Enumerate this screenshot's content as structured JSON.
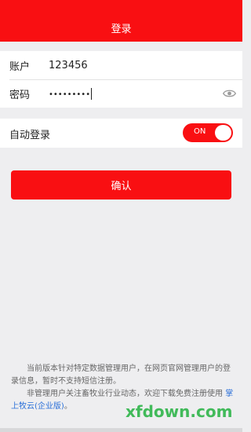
{
  "header": {
    "title": "登录"
  },
  "login": {
    "account_label": "账户",
    "account_value": "123456",
    "password_label": "密码",
    "password_value": "•••••••••"
  },
  "auto_login": {
    "label": "自动登录",
    "toggle_text": "ON",
    "enabled": true
  },
  "confirm_button": "确认",
  "notice": {
    "line1": "当前版本针对特定数据管理用户，在网页官网管理用户的登录信息，暂时不支持短信注册。",
    "line2_prefix": "非管理用户关注畜牧业行业动态，欢迎下载免费注册使用",
    "link": "掌上牧云(企业版)",
    "line2_suffix": "。"
  },
  "watermark": "xfdown.com",
  "colors": {
    "brand_red": "#f90f12",
    "link_blue": "#2a6fd8"
  }
}
